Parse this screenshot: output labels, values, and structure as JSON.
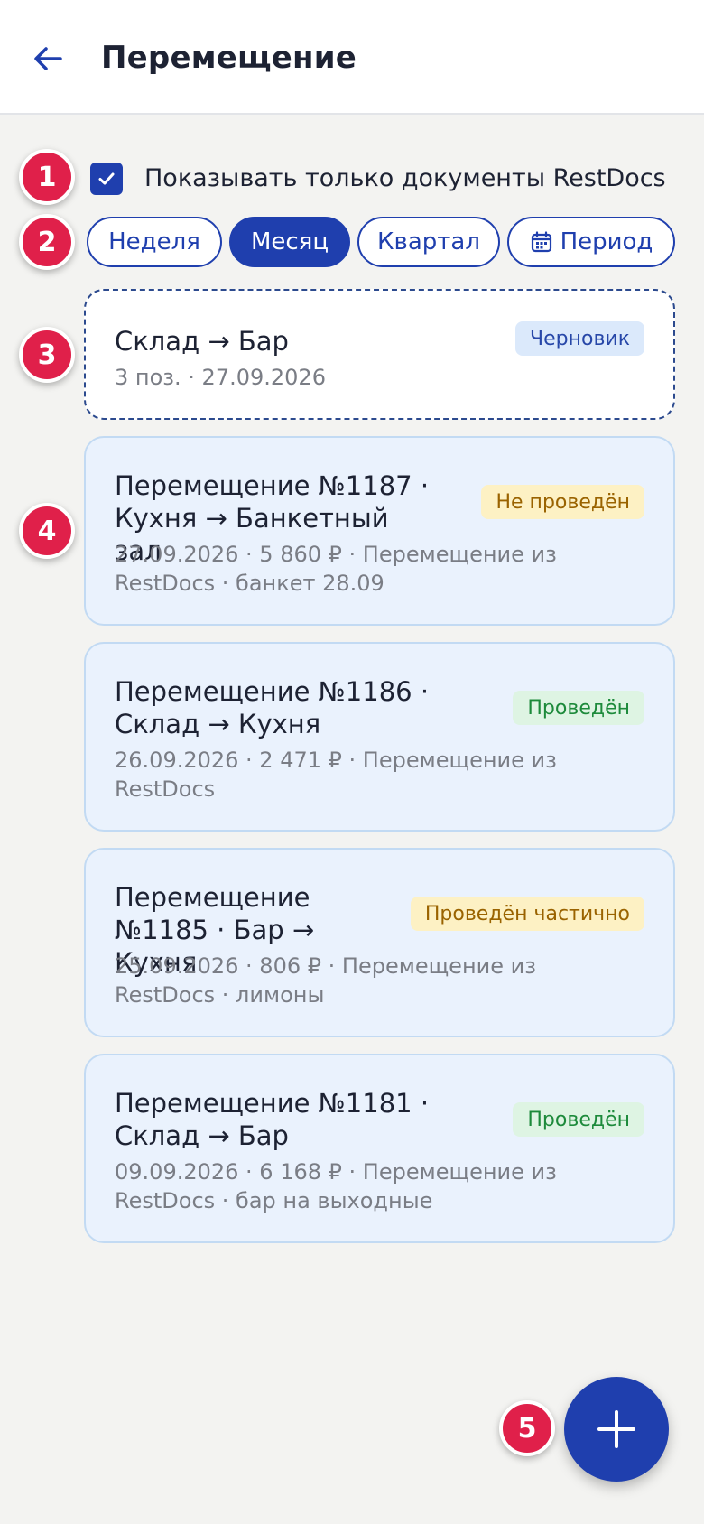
{
  "header": {
    "back_icon": "arrow-left-icon",
    "title": "Перемещение"
  },
  "annotations": [
    "1",
    "2",
    "3",
    "4",
    "5"
  ],
  "filter": {
    "checkbox_checked": true,
    "checkbox_label": "Показывать только документы RestDocs"
  },
  "period_chips": [
    {
      "label": "Неделя",
      "active": false
    },
    {
      "label": "Месяц",
      "active": true
    },
    {
      "label": "Квартал",
      "active": false
    },
    {
      "label": "Период",
      "active": false,
      "icon": "calendar-icon"
    }
  ],
  "documents": [
    {
      "title": "Склад → Бар",
      "subtitle": "3 поз. · 27.09.2026",
      "status": "Черновик",
      "status_type": "draft"
    },
    {
      "title_line1": "Перемещение №1187 ·",
      "title_line2": "Кухня → Банкетный зал",
      "subtitle_line1": "27.09.2026 · 5 860 ₽ · Перемещение из",
      "subtitle_line2": "RestDocs · банкет 28.09",
      "status": "Не проведён",
      "status_type": "notposted"
    },
    {
      "title_line1": "Перемещение №1186 ·",
      "title_line2": "Склад → Кухня",
      "subtitle_line1": "26.09.2026 · 2 471 ₽ · Перемещение из",
      "subtitle_line2": "RestDocs",
      "status": "Проведён",
      "status_type": "posted"
    },
    {
      "title_line1": "Перемещение",
      "title_line2": "№1185 · Бар → Кухня",
      "subtitle_line1": "25.09.2026 · 806 ₽ · Перемещение из",
      "subtitle_line2": "RestDocs · лимоны",
      "status": "Проведён частично",
      "status_type": "partial"
    },
    {
      "title_line1": "Перемещение №1181 ·",
      "title_line2": "Склад → Бар",
      "subtitle_line1": "09.09.2026 · 6 168 ₽ · Перемещение из",
      "subtitle_line2": "RestDocs · бар на выходные",
      "status": "Проведён",
      "status_type": "posted"
    }
  ],
  "fab": {
    "icon": "plus-icon"
  },
  "colors": {
    "accent": "#1f3fae",
    "annotation": "#e0204a",
    "background": "#f3f3f1",
    "card": "#eaf2fd"
  }
}
